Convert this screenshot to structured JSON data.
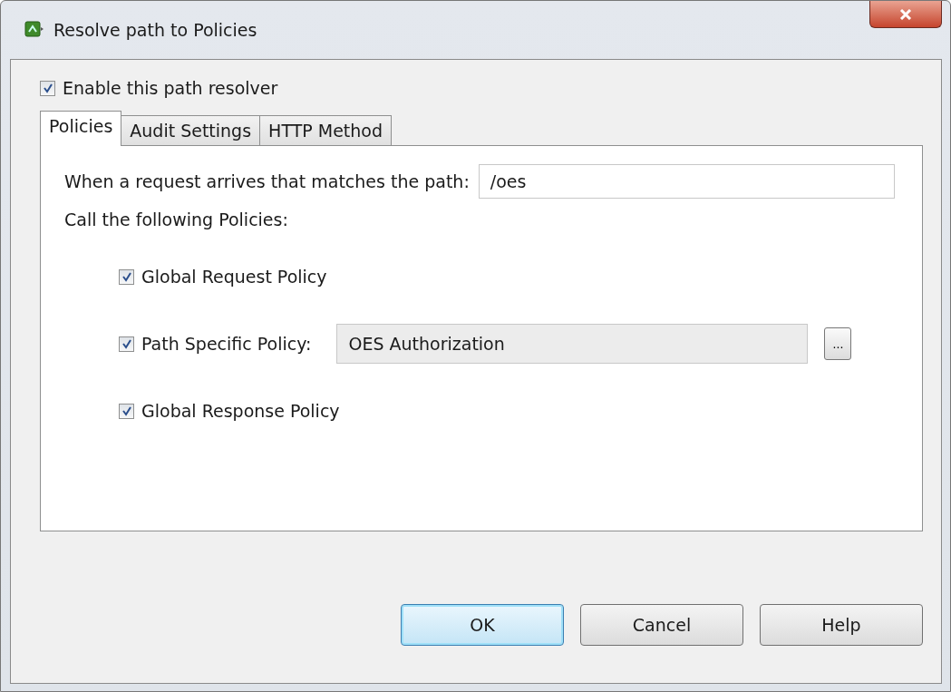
{
  "window": {
    "title": "Resolve path to Policies"
  },
  "enable": {
    "label": "Enable this path resolver",
    "checked": true
  },
  "tabs": [
    {
      "label": "Policies",
      "selected": true
    },
    {
      "label": "Audit Settings",
      "selected": false
    },
    {
      "label": "HTTP Method",
      "selected": false
    }
  ],
  "path": {
    "label": "When a request arrives that matches the path:",
    "value": "/oes"
  },
  "call_label": "Call the following Policies:",
  "policies": [
    {
      "kind": "plain",
      "label": "Global Request Policy",
      "checked": true
    },
    {
      "kind": "field",
      "label": "Path Specific Policy:",
      "checked": true,
      "value": "OES Authorization",
      "browse": "..."
    },
    {
      "kind": "plain",
      "label": "Global Response Policy",
      "checked": true
    }
  ],
  "buttons": [
    {
      "label": "OK",
      "default": true
    },
    {
      "label": "Cancel",
      "default": false
    },
    {
      "label": "Help",
      "default": false
    }
  ]
}
